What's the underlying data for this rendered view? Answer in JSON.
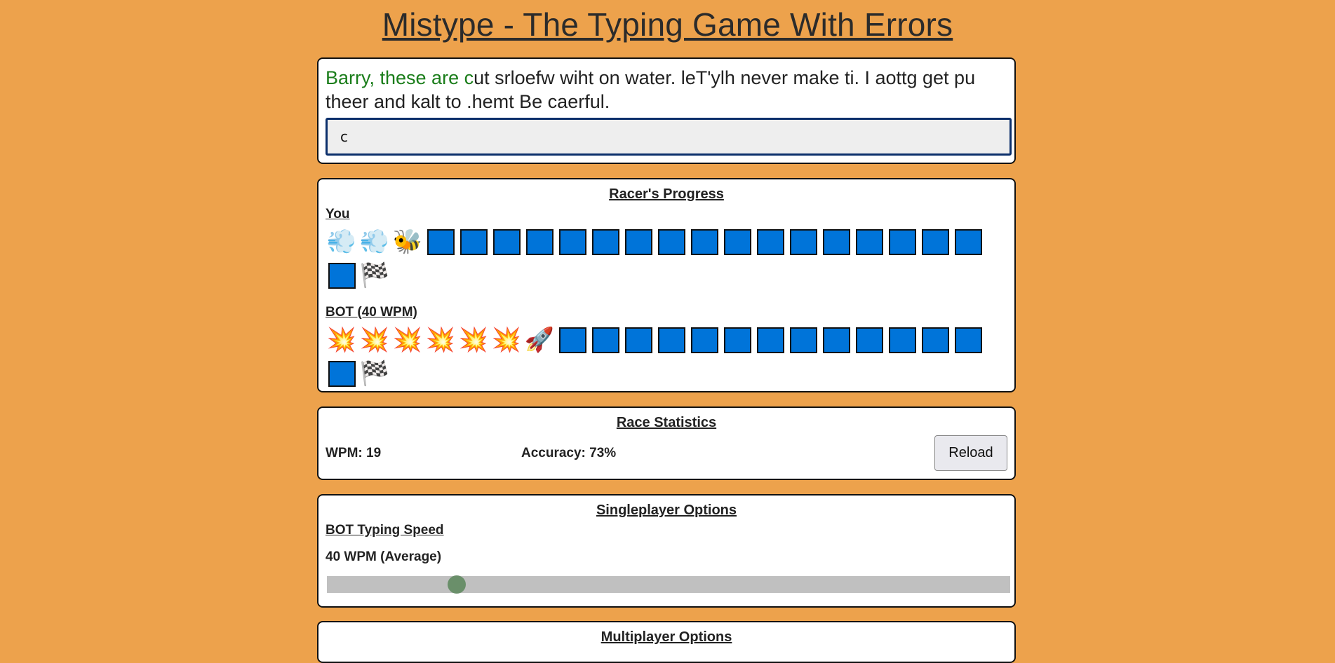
{
  "page": {
    "title": "Mistype - The Typing Game With Errors"
  },
  "passage": {
    "typed": "Barry, these are c",
    "remaining": "ut srloefw wiht on water. leT'ylh never make ti. I aottg get pu theer and kalt to .hemt Be caerful."
  },
  "input": {
    "value": "c"
  },
  "progress": {
    "title": "Racer's Progress",
    "you": {
      "label": "You",
      "trail": [
        "wind-puff-icon",
        "wind-puff-icon"
      ],
      "racer": "bee-icon",
      "remaining_squares": 18,
      "finish": "checkered-flag-icon"
    },
    "bot": {
      "label": "BOT (40 WPM)",
      "trail": [
        "collision-icon",
        "collision-icon",
        "collision-icon",
        "collision-icon",
        "collision-icon",
        "collision-icon"
      ],
      "racer": "rocket-icon",
      "remaining_squares": 14,
      "finish": "checkered-flag-icon"
    }
  },
  "stats": {
    "title": "Race Statistics",
    "wpm": "WPM: 19",
    "accuracy": "Accuracy: 73%",
    "reload_label": "Reload"
  },
  "singleplayer": {
    "title": "Singleplayer Options",
    "speed_label": "BOT Typing Speed",
    "speed_value": "40 WPM (Average)",
    "slider_fraction": 0.19
  },
  "multiplayer": {
    "title": "Multiplayer Options"
  },
  "colors": {
    "background": "#eda24c",
    "square": "#0074d9",
    "typed_text": "#1a7d1a"
  },
  "icons": {
    "wind-puff-icon": "💨",
    "bee-icon": "🐝",
    "collision-icon": "💥",
    "rocket-icon": "🚀",
    "checkered-flag-icon": "🏁"
  }
}
